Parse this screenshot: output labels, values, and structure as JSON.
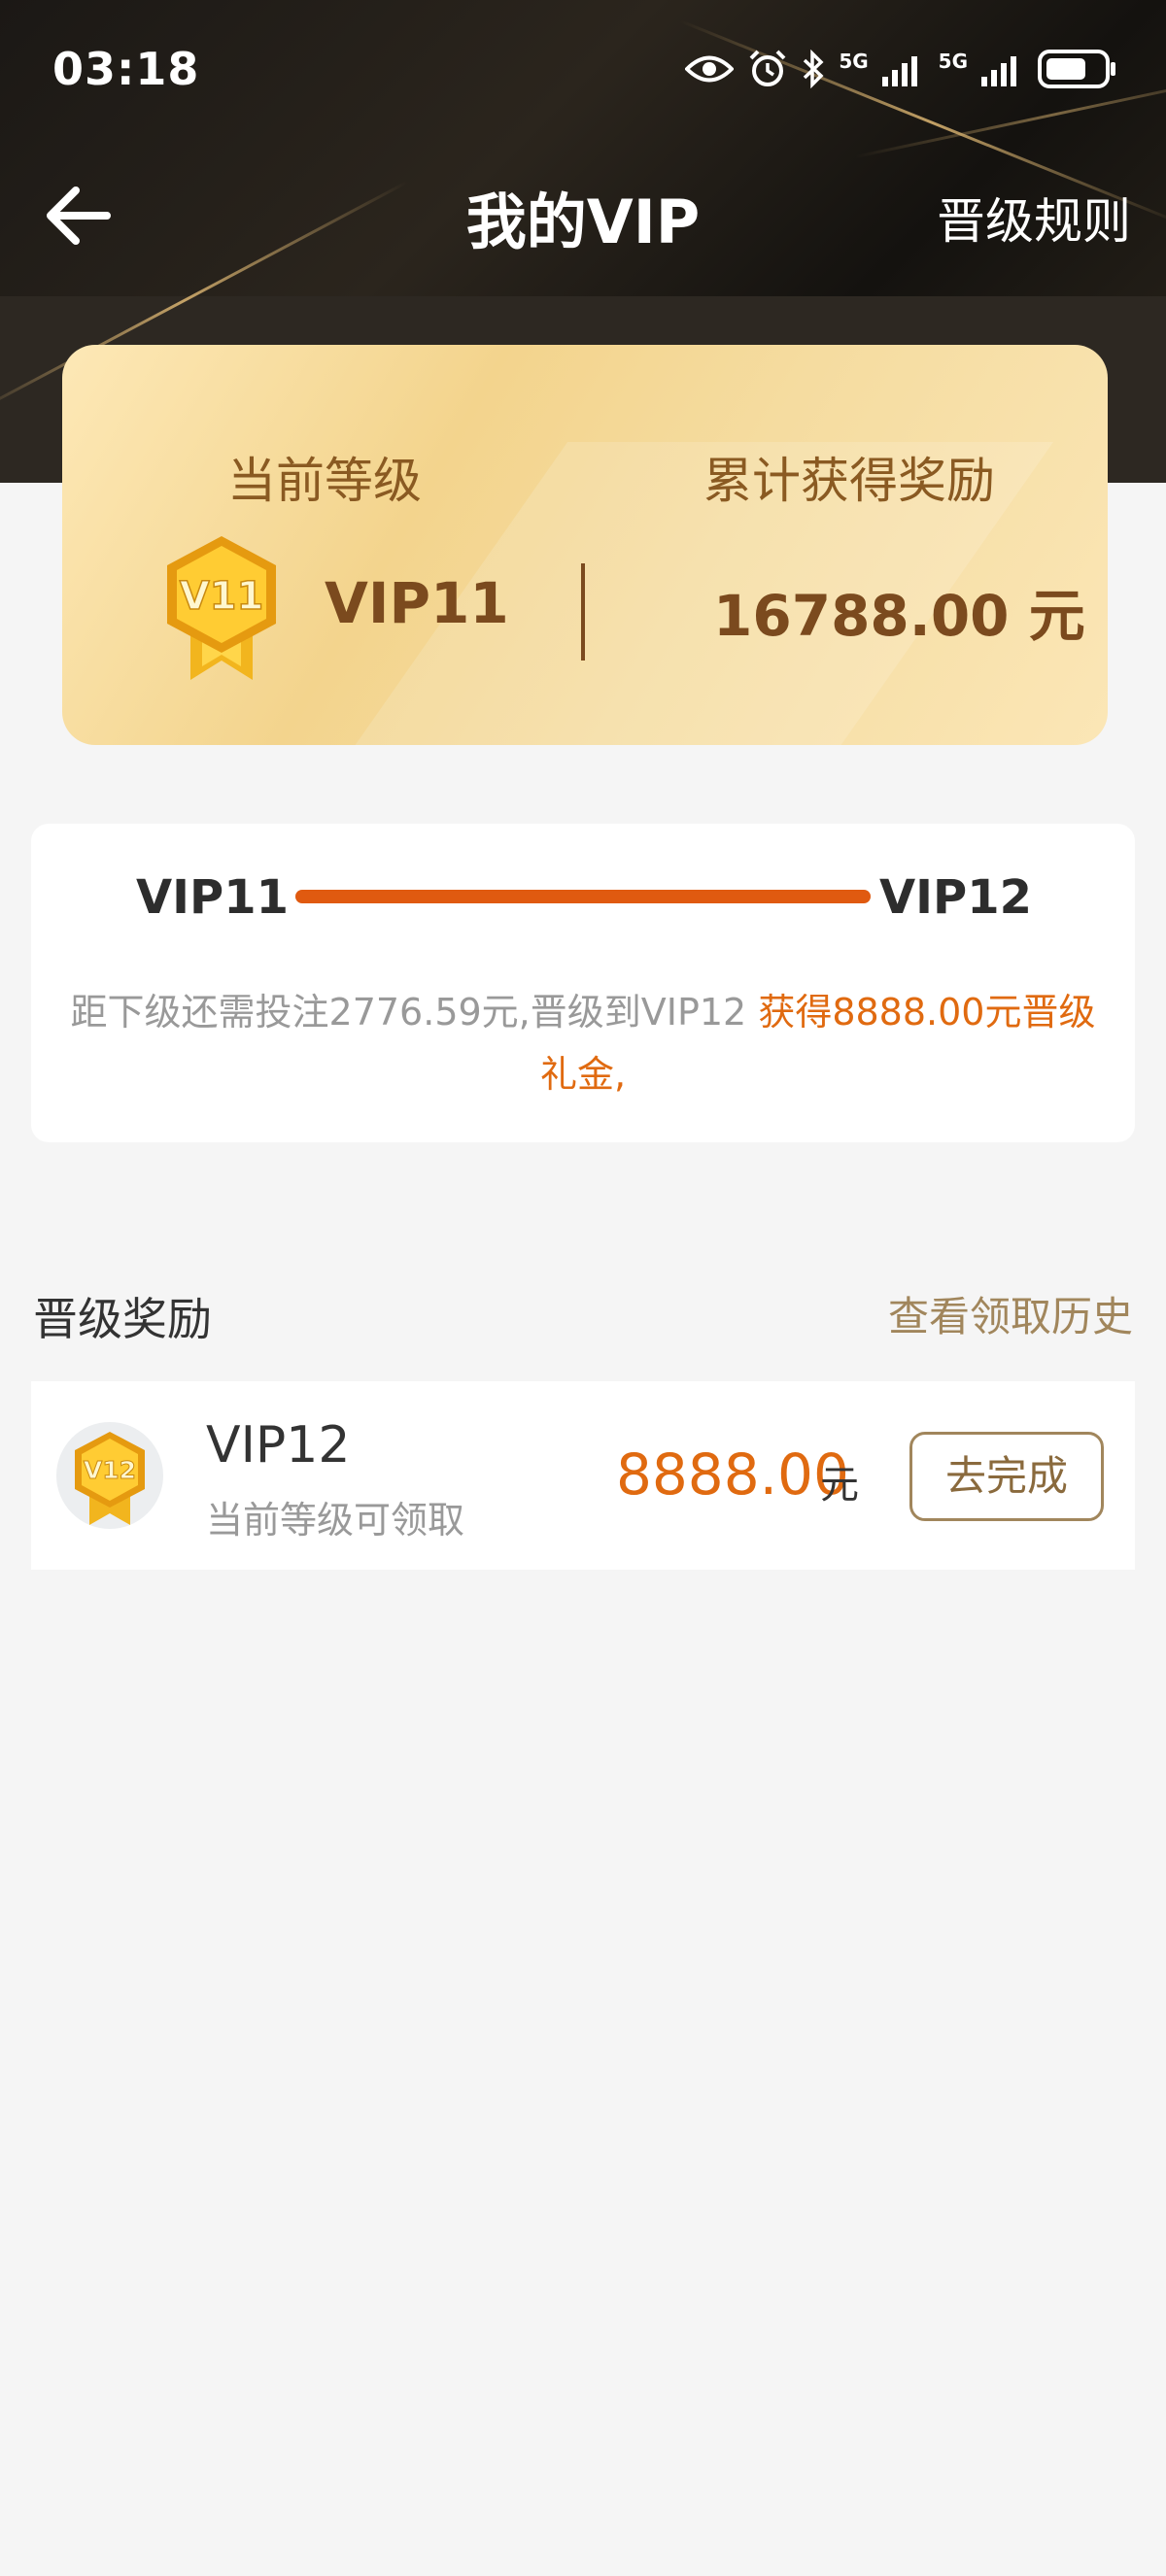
{
  "status_bar": {
    "time": "03:18",
    "network_1": "5G",
    "network_2": "5G",
    "icons": [
      "eye-icon",
      "alarm-icon",
      "bluetooth-icon",
      "signal-icon",
      "signal-icon",
      "battery-icon"
    ]
  },
  "nav": {
    "title": "我的VIP",
    "rules_link": "晋级规则"
  },
  "vip_card": {
    "current_level_label": "当前等级",
    "total_reward_label": "累计获得奖励",
    "badge_text": "V11",
    "level": "VIP11",
    "amount": "16788.00 元"
  },
  "progress": {
    "from_level": "VIP11",
    "to_level": "VIP12",
    "fraction": 1.0,
    "text_gray": "距下级还需投注2776.59元,晋级到VIP12 ",
    "text_highlight": "获得8888.00元晋级礼金,"
  },
  "section": {
    "title": "晋级奖励",
    "history_link": "查看领取历史"
  },
  "reward": {
    "badge_text": "V12",
    "level": "VIP12",
    "subtitle": "当前等级可领取",
    "amount": "8888.00",
    "unit": "元",
    "button": "去完成"
  },
  "colors": {
    "accent_orange": "#e06a10",
    "brown_text": "#7b4a1e",
    "gold_light": "#fde8b6",
    "button_border": "#a1865c"
  }
}
